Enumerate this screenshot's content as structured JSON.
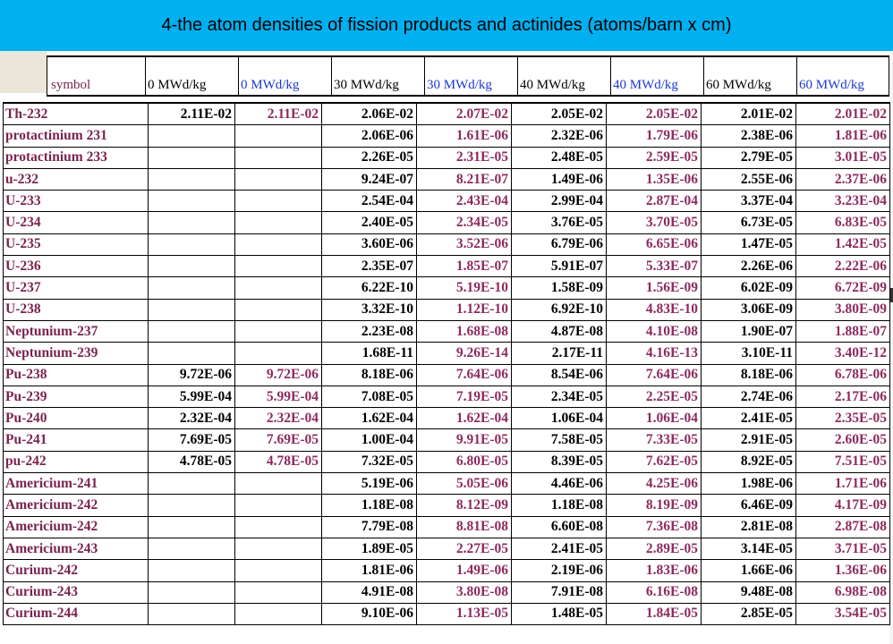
{
  "title": "4-the atom densities of fission products and actinides (atoms/barn x cm)",
  "colors": {
    "title_bar": "#00b0f0",
    "nuclide_name": "#7a2450",
    "alt_value": "#8c2a5e",
    "blue_header": "#1a37d6"
  },
  "headers": [
    "symbol",
    "0 MWd/kg",
    "0 MWd/kg",
    "30 MWd/kg",
    "30 MWd/kg",
    "40 MWd/kg",
    "40 MWd/kg",
    "60 MWd/kg",
    "60 MWd/kg"
  ],
  "rows": [
    {
      "name": "Th-232",
      "values": [
        "2.11E-02",
        "2.11E-02",
        "2.06E-02",
        "2.07E-02",
        "2.05E-02",
        "2.05E-02",
        "2.01E-02",
        "2.01E-02"
      ]
    },
    {
      "name": "protactinium 231",
      "values": [
        "",
        "",
        "2.06E-06",
        "1.61E-06",
        "2.32E-06",
        "1.79E-06",
        "2.38E-06",
        "1.81E-06"
      ]
    },
    {
      "name": "protactinium 233",
      "values": [
        "",
        "",
        "2.26E-05",
        "2.31E-05",
        "2.48E-05",
        "2.59E-05",
        "2.79E-05",
        "3.01E-05"
      ]
    },
    {
      "name": "u-232",
      "values": [
        "",
        "",
        "9.24E-07",
        "8.21E-07",
        "1.49E-06",
        "1.35E-06",
        "2.55E-06",
        "2.37E-06"
      ]
    },
    {
      "name": "U-233",
      "values": [
        "",
        "",
        "2.54E-04",
        "2.43E-04",
        "2.99E-04",
        "2.87E-04",
        "3.37E-04",
        "3.23E-04"
      ]
    },
    {
      "name": "U-234",
      "values": [
        "",
        "",
        "2.40E-05",
        "2.34E-05",
        "3.76E-05",
        "3.70E-05",
        "6.73E-05",
        "6.83E-05"
      ]
    },
    {
      "name": "U-235",
      "values": [
        "",
        "",
        "3.60E-06",
        "3.52E-06",
        "6.79E-06",
        "6.65E-06",
        "1.47E-05",
        "1.42E-05"
      ]
    },
    {
      "name": "U-236",
      "values": [
        "",
        "",
        "2.35E-07",
        "1.85E-07",
        "5.91E-07",
        "5.33E-07",
        "2.26E-06",
        "2.22E-06"
      ]
    },
    {
      "name": "U-237",
      "values": [
        "",
        "",
        "6.22E-10",
        "5.19E-10",
        "1.58E-09",
        "1.56E-09",
        "6.02E-09",
        "6.72E-09"
      ]
    },
    {
      "name": "U-238",
      "values": [
        "",
        "",
        "3.32E-10",
        "1.12E-10",
        "6.92E-10",
        "4.83E-10",
        "3.06E-09",
        "3.80E-09"
      ]
    },
    {
      "name": "Neptunium-237",
      "values": [
        "",
        "",
        "2.23E-08",
        "1.68E-08",
        "4.87E-08",
        "4.10E-08",
        "1.90E-07",
        "1.88E-07"
      ]
    },
    {
      "name": "Neptunium-239",
      "values": [
        "",
        "",
        "1.68E-11",
        "9.26E-14",
        "2.17E-11",
        "4.16E-13",
        "3.10E-11",
        "3.40E-12"
      ]
    },
    {
      "name": "Pu-238",
      "values": [
        "9.72E-06",
        "9.72E-06",
        "8.18E-06",
        "7.64E-06",
        "8.54E-06",
        "7.64E-06",
        "8.18E-06",
        "6.78E-06"
      ]
    },
    {
      "name": "Pu-239",
      "values": [
        "5.99E-04",
        "5.99E-04",
        "7.08E-05",
        "7.19E-05",
        "2.34E-05",
        "2.25E-05",
        "2.74E-06",
        "2.17E-06"
      ]
    },
    {
      "name": "Pu-240",
      "values": [
        "2.32E-04",
        "2.32E-04",
        "1.62E-04",
        "1.62E-04",
        "1.06E-04",
        "1.06E-04",
        "2.41E-05",
        "2.35E-05"
      ]
    },
    {
      "name": "Pu-241",
      "values": [
        "7.69E-05",
        "7.69E-05",
        "1.00E-04",
        "9.91E-05",
        "7.58E-05",
        "7.33E-05",
        "2.91E-05",
        "2.60E-05"
      ]
    },
    {
      "name": "pu-242",
      "values": [
        "4.78E-05",
        "4.78E-05",
        "7.32E-05",
        "6.80E-05",
        "8.39E-05",
        "7.62E-05",
        "8.92E-05",
        "7.51E-05"
      ]
    },
    {
      "name": "Americium-241",
      "values": [
        "",
        "",
        "5.19E-06",
        "5.05E-06",
        "4.46E-06",
        "4.25E-06",
        "1.98E-06",
        "1.71E-06"
      ]
    },
    {
      "name": "Americium-242",
      "values": [
        "",
        "",
        "1.18E-08",
        "8.12E-09",
        "1.18E-08",
        "8.19E-09",
        "6.46E-09",
        "4.17E-09"
      ]
    },
    {
      "name": "Americium-242",
      "values": [
        "",
        "",
        "7.79E-08",
        "8.81E-08",
        "6.60E-08",
        "7.36E-08",
        "2.81E-08",
        "2.87E-08"
      ]
    },
    {
      "name": "Americium-243",
      "values": [
        "",
        "",
        "1.89E-05",
        "2.27E-05",
        "2.41E-05",
        "2.89E-05",
        "3.14E-05",
        "3.71E-05"
      ]
    },
    {
      "name": "Curium-242",
      "values": [
        "",
        "",
        "1.81E-06",
        "1.49E-06",
        "2.19E-06",
        "1.83E-06",
        "1.66E-06",
        "1.36E-06"
      ]
    },
    {
      "name": "Curium-243",
      "values": [
        "",
        "",
        "4.91E-08",
        "3.80E-08",
        "7.91E-08",
        "6.16E-08",
        "9.48E-08",
        "6.98E-08"
      ]
    },
    {
      "name": "Curium-244",
      "values": [
        "",
        "",
        "9.10E-06",
        "1.13E-05",
        "1.48E-05",
        "1.84E-05",
        "2.85E-05",
        "3.54E-05"
      ]
    }
  ]
}
